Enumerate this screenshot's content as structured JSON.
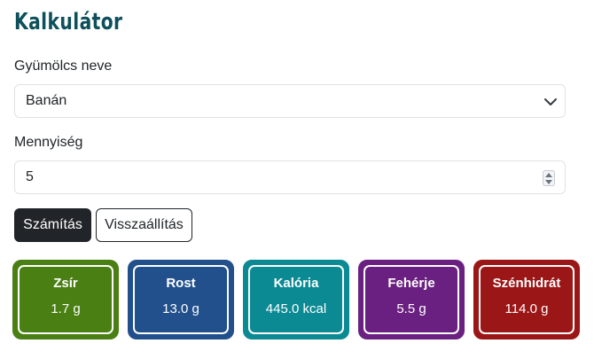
{
  "title": "Kalkulátor",
  "fruit": {
    "label": "Gyümölcs neve",
    "selected": "Banán"
  },
  "quantity": {
    "label": "Mennyiség",
    "value": "5"
  },
  "buttons": {
    "calculate": "Számítás",
    "reset": "Visszaállítás"
  },
  "results": [
    {
      "name": "Zsír",
      "value": "1.7 g",
      "color": "#4a7f14"
    },
    {
      "name": "Rost",
      "value": "13.0 g",
      "color": "#22508c"
    },
    {
      "name": "Kalória",
      "value": "445.0 kcal",
      "color": "#0b8a94"
    },
    {
      "name": "Fehérje",
      "value": "5.5 g",
      "color": "#6a2080"
    },
    {
      "name": "Szénhidrát",
      "value": "114.0 g",
      "color": "#9b1616"
    }
  ]
}
